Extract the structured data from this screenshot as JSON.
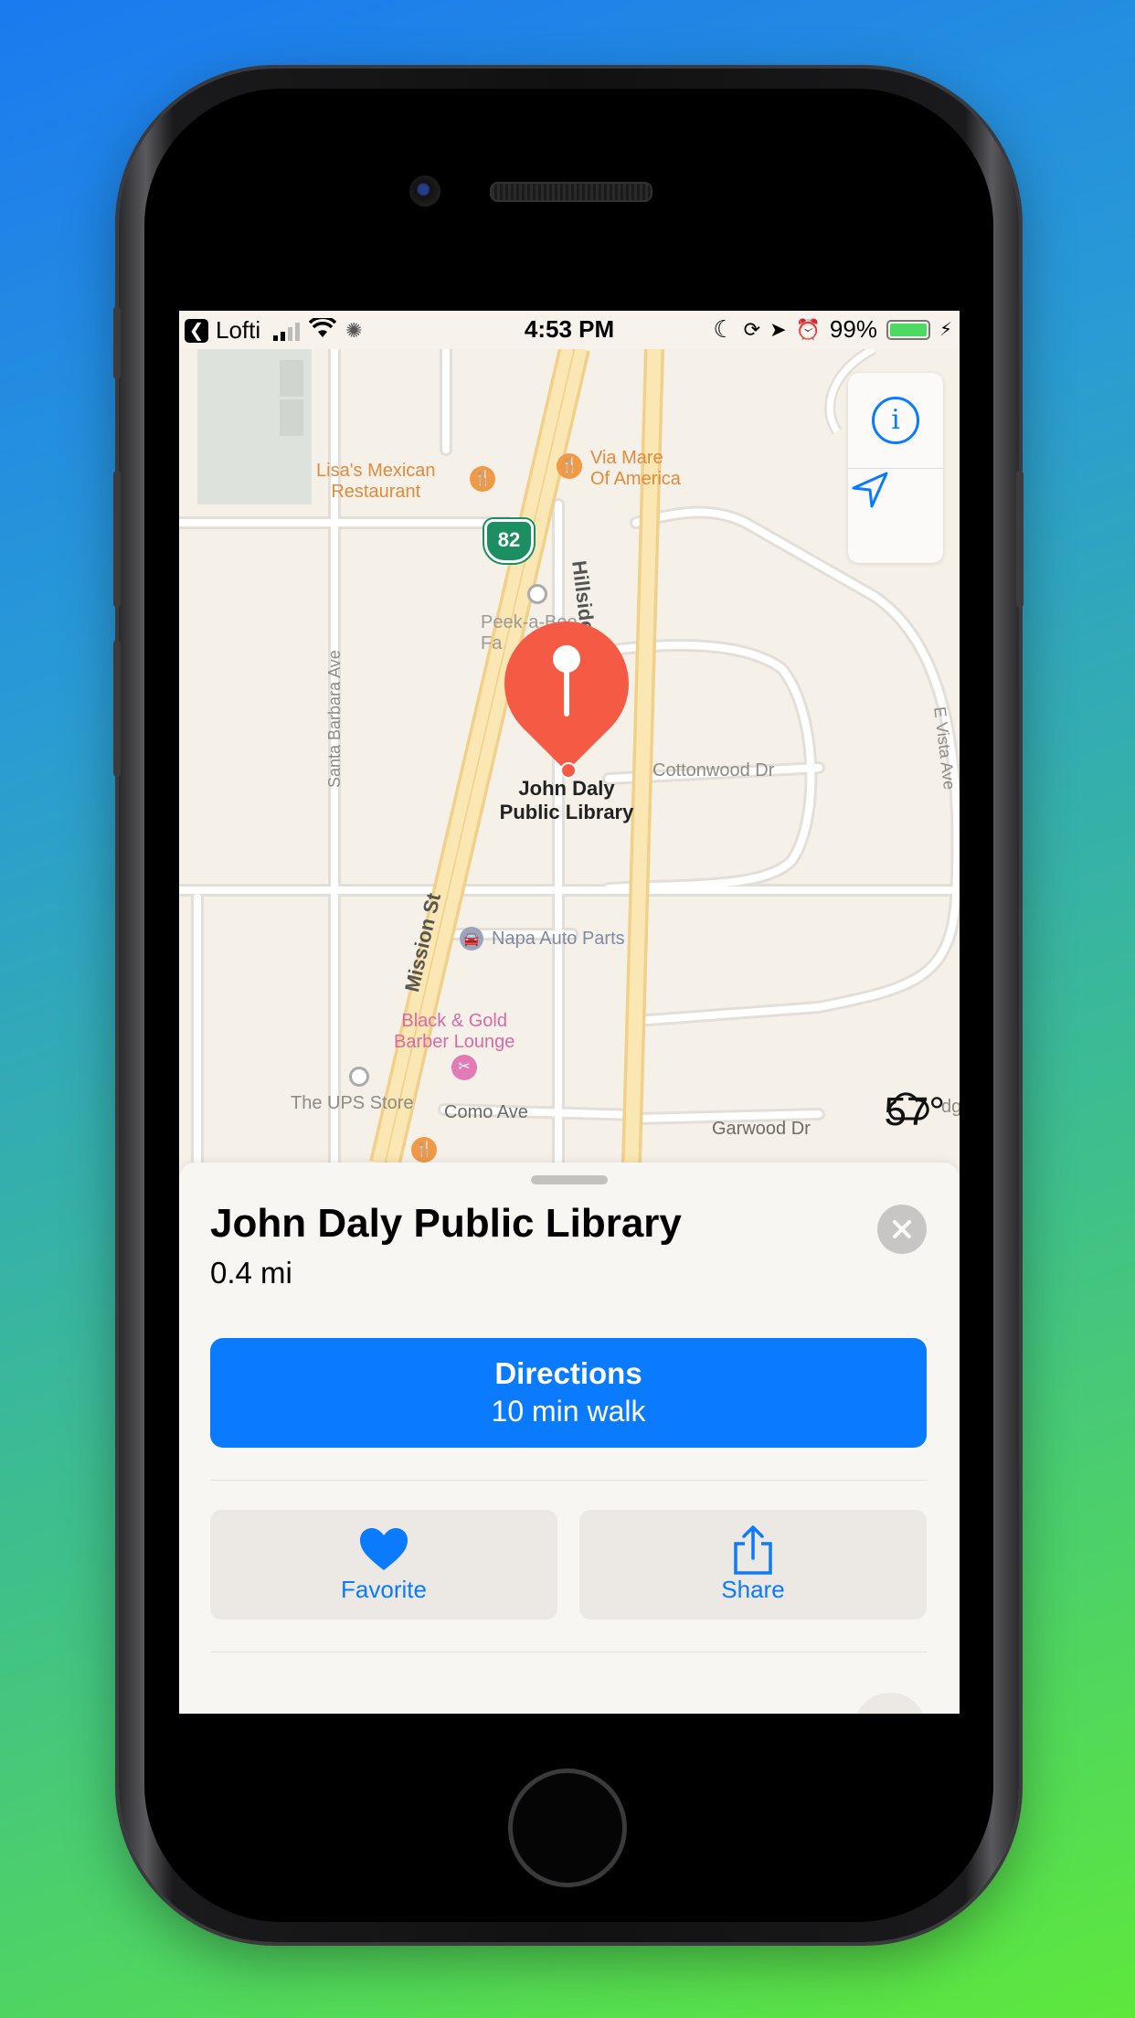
{
  "status_bar": {
    "back_app": "Lofti",
    "time": "4:53 PM",
    "battery": "99%",
    "battery_level": 0.99
  },
  "map": {
    "labels": {
      "lisas": "Lisa's Mexican\nRestaurant",
      "via_mare": "Via Mare\nOf America",
      "route_shield": "82",
      "hillside": "Hillside",
      "peek": "Peek-a-Boo\nFa",
      "santa_barbara": "Santa Barbara Ave",
      "cottonwood": "Cottonwood Dr",
      "e_vista": "E Vista Ave",
      "mission": "Mission St",
      "napa": "Napa Auto Parts",
      "black_gold": "Black & Gold\nBarber Lounge",
      "ups": "The UPS Store",
      "como": "Como Ave",
      "garwood": "Garwood Dr",
      "edge": "dg"
    },
    "selected_pin_label": "John Daly\nPublic Library",
    "weather": {
      "icon": "cloud-icon",
      "temperature": "57°"
    },
    "controls": {
      "info_icon": "info-icon",
      "location_icon": "location-arrow-icon"
    }
  },
  "sheet": {
    "title": "John Daly Public Library",
    "distance": "0.4 mi",
    "directions": {
      "label": "Directions",
      "eta": "10 min walk"
    },
    "actions": [
      {
        "label": "Favorite",
        "icon": "heart-icon"
      },
      {
        "label": "Share",
        "icon": "share-icon"
      }
    ]
  },
  "colors": {
    "accent": "#0a7aff",
    "pin": "#f55a45",
    "poi_food": "#e08a3c",
    "poi_beauty": "#d86aa6"
  }
}
